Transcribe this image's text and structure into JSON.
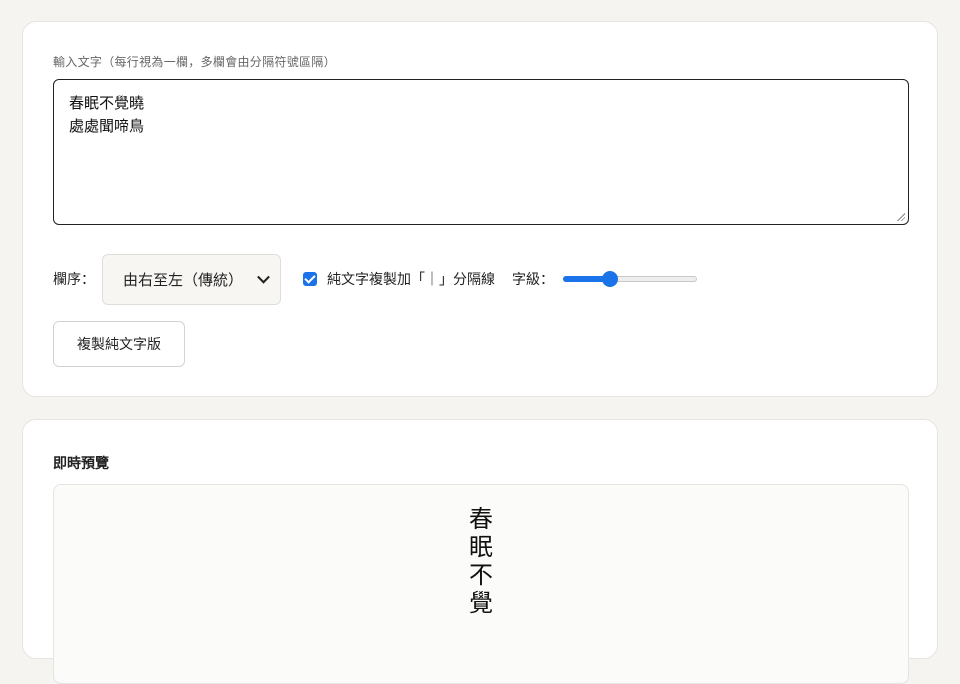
{
  "input": {
    "label": "輸入文字（每行視為一欄，多欄會由分隔符號區隔）",
    "lines": [
      "春眠不覺曉",
      "處處聞啼鳥"
    ]
  },
  "controls": {
    "order_label": "欄序：",
    "order_selected": "由右至左（傳統）",
    "checkbox_checked": true,
    "checkbox_label": "純文字複製加「｜」分隔線",
    "size_label": "字級：",
    "size_fraction": 0.33,
    "accent_color": "#1a73e8"
  },
  "copy_button": {
    "label": "複製純文字版"
  },
  "preview": {
    "title": "即時預覽",
    "column_chars": [
      "春",
      "眠",
      "不",
      "覺"
    ]
  }
}
